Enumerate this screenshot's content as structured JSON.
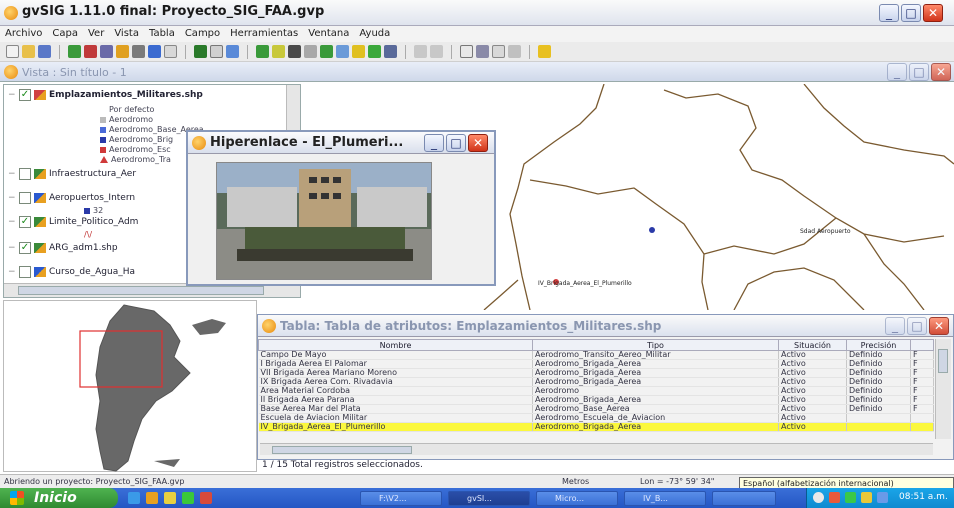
{
  "app": {
    "title": "gvSIG 1.11.0 final: Proyecto_SIG_FAA.gvp",
    "menu": [
      "Archivo",
      "Capa",
      "Ver",
      "Vista",
      "Tabla",
      "Campo",
      "Herramientas",
      "Ventana",
      "Ayuda"
    ]
  },
  "view": {
    "title": "Vista : Sin título - 1"
  },
  "toc": {
    "layers": [
      {
        "name": "Emplazamientos_Militares.shp",
        "checked": true
      },
      {
        "name": "Infraestructura_Aer",
        "checked": false
      },
      {
        "name": "Aeropuertos_Intern",
        "checked": false
      },
      {
        "name": "Limite_Politico_Adm",
        "checked": true
      },
      {
        "name": "ARG_adm1.shp",
        "checked": true
      },
      {
        "name": "Curso_de_Agua_Ha",
        "checked": false
      }
    ],
    "legend": [
      "Por defecto",
      "Aerodromo",
      "Aerodromo_Base_Aerea",
      "Aerodromo_Brig",
      "Aerodromo_Esc",
      "Aerodromo_Tra"
    ],
    "legend_value": "32"
  },
  "map": {
    "labels": [
      "Sdad Aeropuerto",
      "IV_Brigada_Aerea_El_Plumerillo"
    ]
  },
  "popup": {
    "title": "Hiperenlace - El_Plumeri..."
  },
  "table": {
    "title": "Tabla: Tabla de atributos: Emplazamientos_Militares.shp",
    "columns": [
      "Nombre",
      "Tipo",
      "Situación",
      "Precisión",
      ""
    ],
    "rows": [
      [
        "Campo De Mayo",
        "Aerodromo_Transito_Aereo_Militar",
        "Activo",
        "Definido",
        "F"
      ],
      [
        "I Brigada Aerea El Palomar",
        "Aerodromo_Brigada_Aerea",
        "Activo",
        "Definido",
        "F"
      ],
      [
        "VII Brigada Aerea Mariano Moreno",
        "Aerodromo_Brigada_Aerea",
        "Activo",
        "Definido",
        "F"
      ],
      [
        "IX Brigada Aerea Com. Rivadavia",
        "Aerodromo_Brigada_Aerea",
        "Activo",
        "Definido",
        "F"
      ],
      [
        "Area Material Cordoba",
        "Aerodromo",
        "Activo",
        "Definido",
        "F"
      ],
      [
        "II Brigada Aerea Parana",
        "Aerodromo_Brigada_Aerea",
        "Activo",
        "Definido",
        "F"
      ],
      [
        "Base Aerea Mar del Plata",
        "Aerodromo_Base_Aerea",
        "Activo",
        "Definido",
        "F"
      ],
      [
        "Escuela de Aviacion Militar",
        "Aerodromo_Escuela_de_Aviacion",
        "Activo",
        "",
        ""
      ],
      [
        "IV_Brigada_Aerea_El_Plumerillo",
        "Aerodromo_Brigada_Aerea",
        "Activo",
        "",
        ""
      ]
    ],
    "selected_row": 8,
    "footer": "1 / 15 Total registros seleccionados."
  },
  "status": {
    "message": "Abriendo un proyecto: Proyecto_SIG_FAA.gvp",
    "units": "Metros",
    "coords": "Lon = -73° 59' 34\"",
    "lang": "Español (alfabetización internacional)"
  },
  "taskbar": {
    "start": "Inicio",
    "tasks": [
      "F:\\V2...",
      "gvSI...",
      "Micro...",
      "IV_B...",
      ""
    ],
    "clock": "08:51 a.m."
  },
  "colors": {
    "selection": "#fbf83d",
    "taskbar": "#2456c4",
    "start": "#3c9c3e"
  }
}
